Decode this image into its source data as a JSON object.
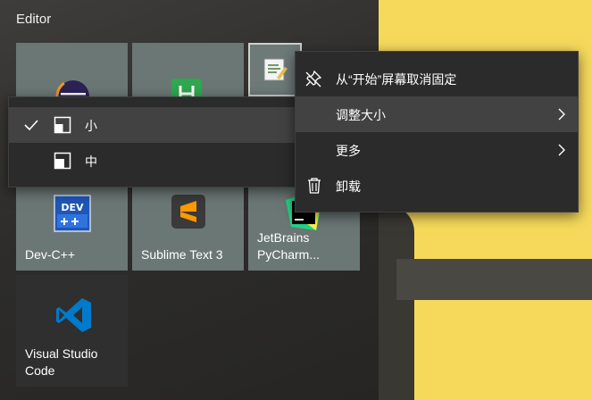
{
  "group": {
    "title": "Editor"
  },
  "tiles": {
    "eclipse": {
      "label": ""
    },
    "hbuilder": {
      "label": ""
    },
    "notepad": {
      "label": ""
    },
    "devcpp": {
      "label": "Dev-C++",
      "icon_text": "DEV"
    },
    "sublime": {
      "label": "Sublime Text 3"
    },
    "pycharm": {
      "label": "JetBrains\nPyCharm..."
    },
    "vscode": {
      "label": "Visual Studio\nCode"
    }
  },
  "main_menu": {
    "items": [
      {
        "label": "从“开始”屏幕取消固定",
        "icon": "unpin-icon"
      },
      {
        "label": "调整大小",
        "icon": "",
        "has_submenu": true
      },
      {
        "label": "更多",
        "icon": "",
        "has_submenu": true
      },
      {
        "label": "卸载",
        "icon": "trash-icon"
      }
    ]
  },
  "resize_submenu": {
    "items": [
      {
        "label": "小",
        "checked": true,
        "icon": "small-tile-icon"
      },
      {
        "label": "中",
        "checked": false,
        "icon": "medium-tile-icon"
      }
    ]
  },
  "colors": {
    "tile": "#6b7775",
    "menu_bg": "#2b2b2b",
    "menu_hover": "#424242",
    "wallpaper": "#f6d95b"
  }
}
